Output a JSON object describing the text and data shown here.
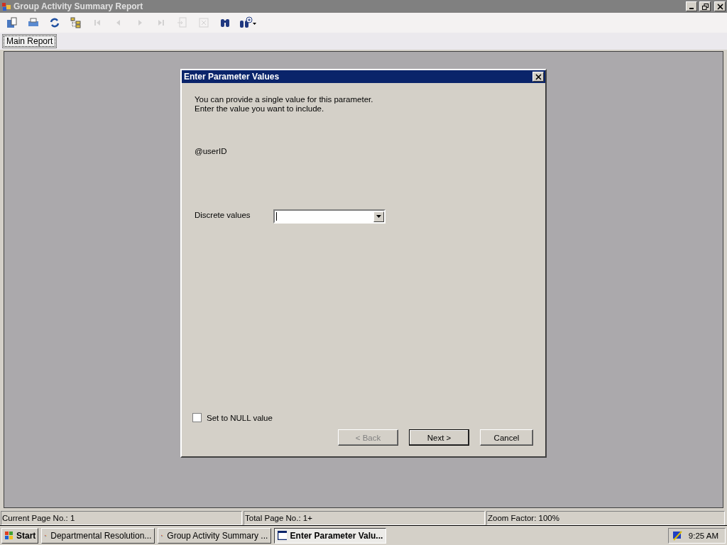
{
  "window": {
    "title": "Group Activity Summary Report"
  },
  "toolbar": [
    {
      "kind": "export",
      "disabled": false
    },
    {
      "kind": "print",
      "disabled": false
    },
    {
      "kind": "refresh",
      "disabled": false
    },
    {
      "kind": "tree",
      "disabled": false
    },
    {
      "kind": "first",
      "disabled": true
    },
    {
      "kind": "prev",
      "disabled": true
    },
    {
      "kind": "next",
      "disabled": true
    },
    {
      "kind": "last",
      "disabled": true
    },
    {
      "kind": "goto",
      "disabled": true
    },
    {
      "kind": "stop",
      "disabled": true
    },
    {
      "kind": "find",
      "disabled": false
    },
    {
      "kind": "zoom",
      "disabled": false
    }
  ],
  "tabs": [
    {
      "label": "Main Report",
      "selected": true
    }
  ],
  "dialog": {
    "title": "Enter Parameter Values",
    "intro": [
      "You can provide a single value for this parameter.",
      "Enter the value you want to include."
    ],
    "parameter": "@userID",
    "field_label": "Discrete values",
    "null_option": {
      "label": "Set to NULL value",
      "checked": false
    },
    "buttons": [
      {
        "label": "< Back",
        "disabled": true,
        "default": false
      },
      {
        "label": "Next >",
        "disabled": false,
        "default": true
      },
      {
        "label": "Cancel",
        "disabled": false,
        "default": false
      }
    ]
  },
  "status_bar": [
    "Current Page No.: 1",
    "Total Page No.: 1+",
    "Zoom Factor: 100%"
  ],
  "taskbar": {
    "start": "Start",
    "tasks": [
      {
        "label": "Departmental Resolution...",
        "kind": "report",
        "selected": false
      },
      {
        "label": "Group Activity Summary ...",
        "kind": "report",
        "selected": false
      },
      {
        "label": "Enter Parameter Valu...",
        "kind": "dialog",
        "selected": true
      }
    ],
    "clock": "9:25 AM"
  }
}
